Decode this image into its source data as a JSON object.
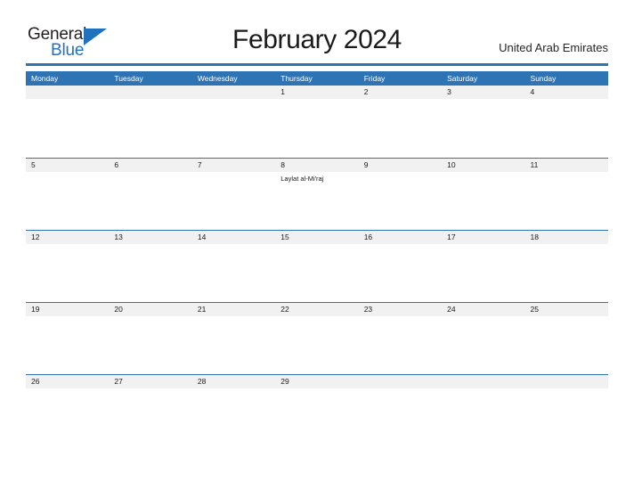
{
  "brand": {
    "name_part1": "General",
    "name_part2": "Blue",
    "triangle_icon": "triangle-right-icon",
    "accent_color": "#1f72bd"
  },
  "header": {
    "title": "February 2024",
    "country": "United Arab Emirates",
    "rule_color": "#2e74b5"
  },
  "calendar": {
    "header_bg": "#2e74b5",
    "band_bg": "#f1f1f1",
    "weekdays": [
      "Monday",
      "Tuesday",
      "Wednesday",
      "Thursday",
      "Friday",
      "Saturday",
      "Sunday"
    ],
    "weeks": [
      {
        "days": [
          {
            "num": "",
            "events": []
          },
          {
            "num": "",
            "events": []
          },
          {
            "num": "",
            "events": []
          },
          {
            "num": "1",
            "events": []
          },
          {
            "num": "2",
            "events": []
          },
          {
            "num": "3",
            "events": []
          },
          {
            "num": "4",
            "events": []
          }
        ]
      },
      {
        "days": [
          {
            "num": "5",
            "events": []
          },
          {
            "num": "6",
            "events": []
          },
          {
            "num": "7",
            "events": []
          },
          {
            "num": "8",
            "events": [
              "Laylat al-Mi'raj"
            ]
          },
          {
            "num": "9",
            "events": []
          },
          {
            "num": "10",
            "events": []
          },
          {
            "num": "11",
            "events": []
          }
        ]
      },
      {
        "days": [
          {
            "num": "12",
            "events": []
          },
          {
            "num": "13",
            "events": []
          },
          {
            "num": "14",
            "events": []
          },
          {
            "num": "15",
            "events": []
          },
          {
            "num": "16",
            "events": []
          },
          {
            "num": "17",
            "events": []
          },
          {
            "num": "18",
            "events": []
          }
        ]
      },
      {
        "days": [
          {
            "num": "19",
            "events": []
          },
          {
            "num": "20",
            "events": []
          },
          {
            "num": "21",
            "events": []
          },
          {
            "num": "22",
            "events": []
          },
          {
            "num": "23",
            "events": []
          },
          {
            "num": "24",
            "events": []
          },
          {
            "num": "25",
            "events": []
          }
        ]
      },
      {
        "days": [
          {
            "num": "26",
            "events": []
          },
          {
            "num": "27",
            "events": []
          },
          {
            "num": "28",
            "events": []
          },
          {
            "num": "29",
            "events": []
          },
          {
            "num": "",
            "events": []
          },
          {
            "num": "",
            "events": []
          },
          {
            "num": "",
            "events": []
          }
        ]
      }
    ]
  }
}
